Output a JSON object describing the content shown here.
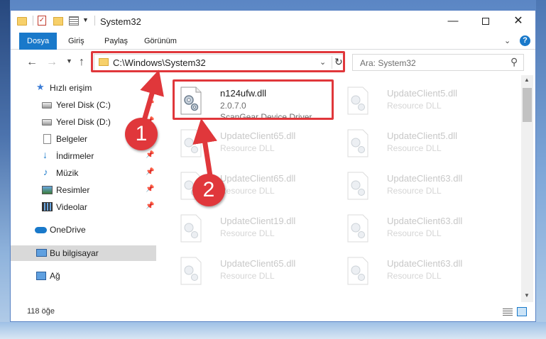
{
  "window": {
    "title": "System32",
    "controls": {
      "minimize": "—",
      "maximize": "",
      "close": "✕"
    }
  },
  "ribbon": {
    "tabs": [
      "Dosya",
      "Giriş",
      "Paylaş",
      "Görünüm"
    ],
    "help": "?"
  },
  "navbar": {
    "address": "C:\\Windows\\System32",
    "search_placeholder": "Ara: System32"
  },
  "sidebar": {
    "items": [
      {
        "label": "Hızlı erişim",
        "icon": "star-icon",
        "pinned": false
      },
      {
        "label": "Yerel Disk (C:)",
        "icon": "drive-icon",
        "pinned": true
      },
      {
        "label": "Yerel Disk (D:)",
        "icon": "drive-icon",
        "pinned": true
      },
      {
        "label": "Belgeler",
        "icon": "documents-icon",
        "pinned": true
      },
      {
        "label": "İndirmeler",
        "icon": "downloads-icon",
        "pinned": true
      },
      {
        "label": "Müzik",
        "icon": "music-icon",
        "pinned": true
      },
      {
        "label": "Resimler",
        "icon": "pictures-icon",
        "pinned": true
      },
      {
        "label": "Videolar",
        "icon": "videos-icon",
        "pinned": true
      },
      {
        "label": "OneDrive",
        "icon": "onedrive-icon",
        "pinned": false
      },
      {
        "label": "Bu bilgisayar",
        "icon": "this-pc-icon",
        "pinned": false,
        "selected": true
      },
      {
        "label": "Ağ",
        "icon": "network-icon",
        "pinned": false
      }
    ]
  },
  "files": {
    "highlighted": {
      "name": "n124ufw.dll",
      "version": "2.0.7.0",
      "description": "ScanGear Device Driver"
    },
    "faded": [
      {
        "name": "UpdateClient5.dll",
        "description": "Resource DLL"
      },
      {
        "name": "UpdateClient65.dll",
        "description": "Resource DLL"
      },
      {
        "name": "UpdateClient5.dll",
        "description": "Resource DLL"
      },
      {
        "name": "UpdateClient65.dll",
        "description": "Resource DLL"
      },
      {
        "name": "UpdateClient63.dll",
        "description": "Resource DLL"
      },
      {
        "name": "UpdateClient19.dll",
        "description": "Resource DLL"
      },
      {
        "name": "UpdateClient63.dll",
        "description": "Resource DLL"
      },
      {
        "name": "UpdateClient65.dll",
        "description": "Resource DLL"
      },
      {
        "name": "UpdateClient63.dll",
        "description": "Resource DLL"
      }
    ]
  },
  "status": {
    "item_count": "118 öğe"
  },
  "annotations": {
    "step1": "1",
    "step2": "2",
    "color": "#e0373b"
  }
}
